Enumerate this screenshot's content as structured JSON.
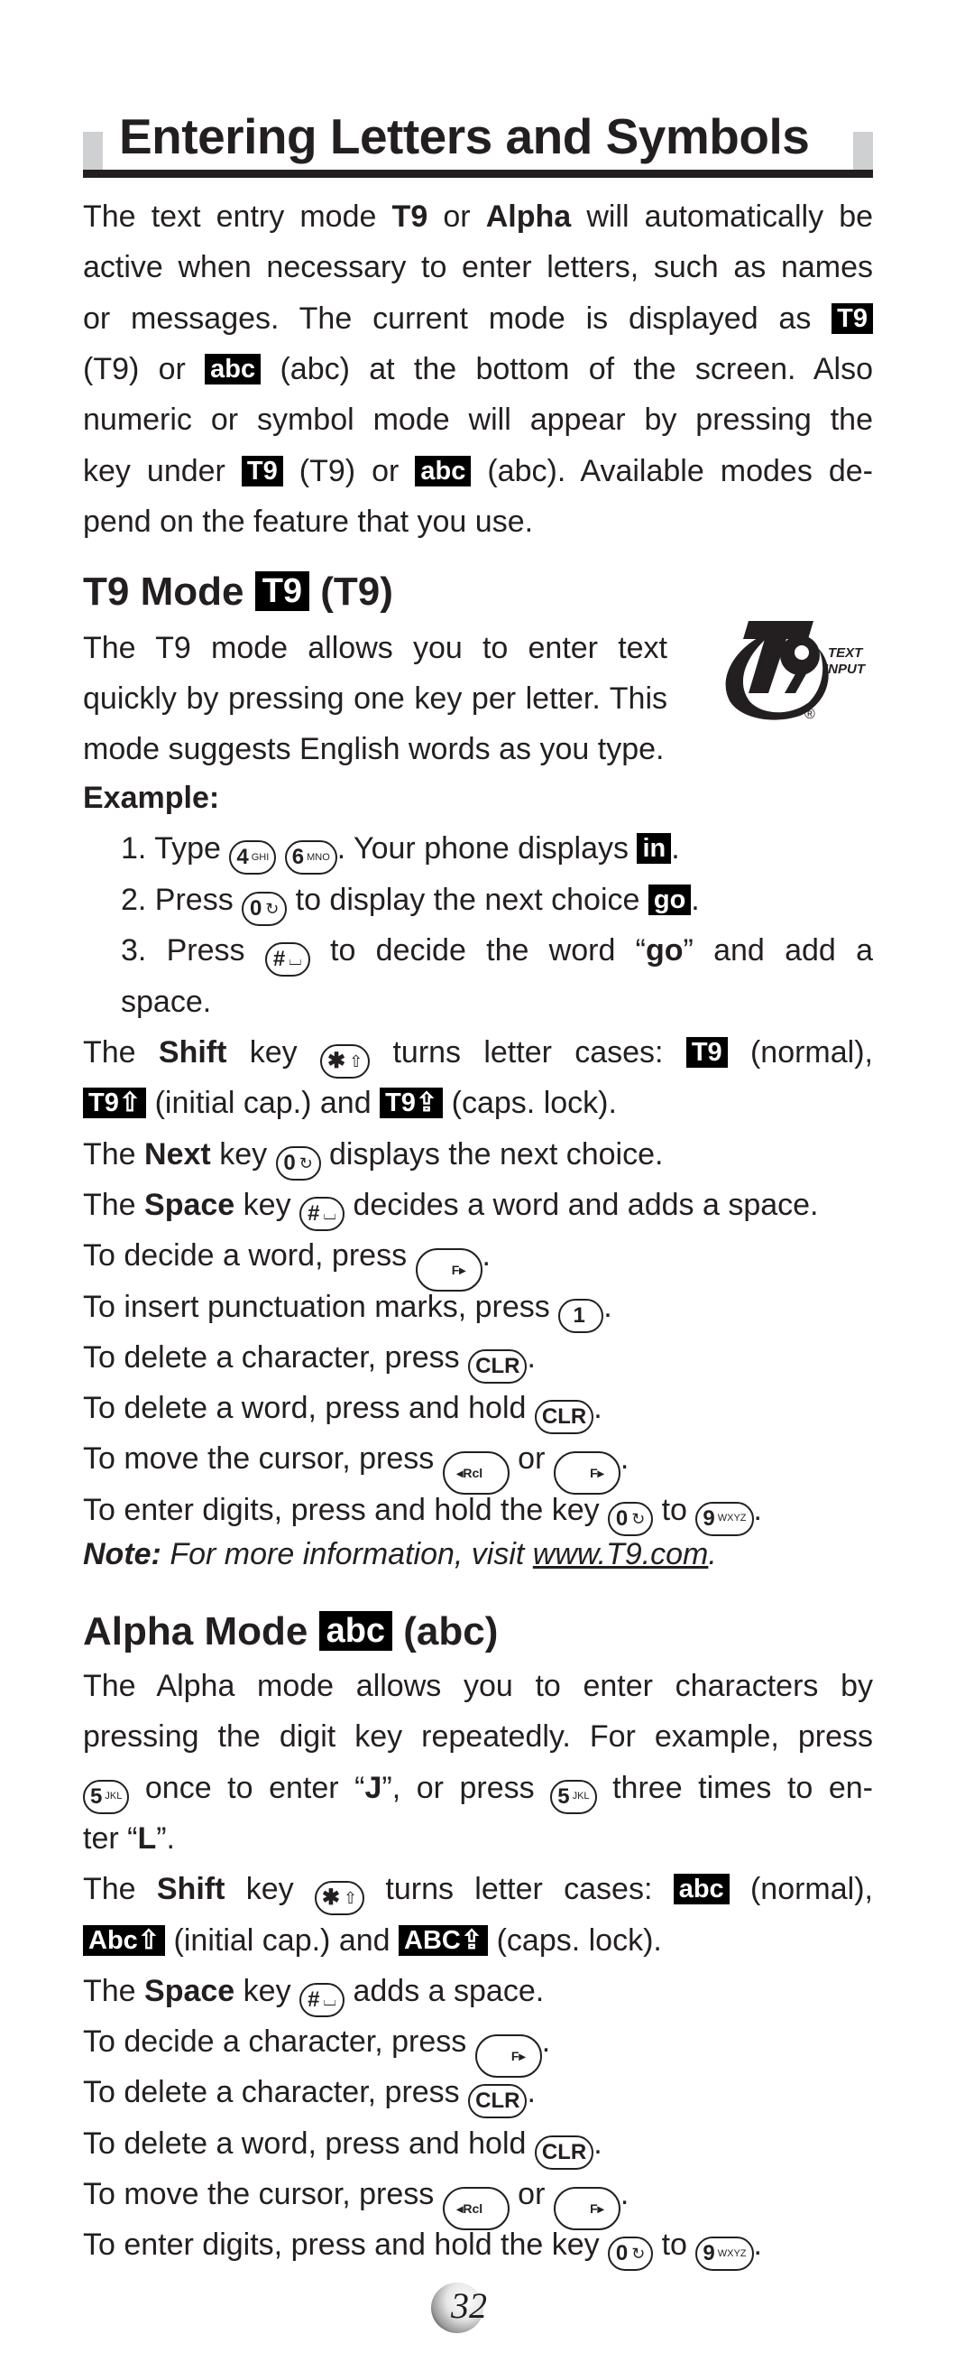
{
  "heading": "Entering Letters and Symbols",
  "intro": {
    "lines": [
      [
        "The text entry mode ",
        {
          "b": "T9"
        },
        " or ",
        {
          "b": "Alpha"
        },
        " will automatically be"
      ],
      [
        "active when necessary to enter letters, such as names"
      ],
      [
        "or messages. The current mode is displayed as ",
        {
          "badge": "T9"
        }
      ],
      [
        "(T9) or ",
        {
          "badge": "abc"
        },
        " (abc) at the bottom of the screen. Also"
      ],
      [
        "numeric or symbol mode will appear by pressing the"
      ],
      [
        "key under ",
        {
          "badge": "T9"
        },
        " (T9) or ",
        {
          "badge": "abc"
        },
        " (abc). Available modes de-"
      ],
      [
        "pend on the feature that you use."
      ]
    ]
  },
  "t9_section": {
    "title_prefix": "T9 Mode",
    "title_badge": "T9",
    "title_suffix": "(T9)",
    "logo": {
      "mark": "T9",
      "line1": "TEXT",
      "line2": "INPUT",
      "reg": "®"
    },
    "desc_lines": [
      "The T9 mode allows you to enter text",
      "quickly by pressing one key per letter. This",
      "mode suggests English words as you type."
    ],
    "example_label": "Example:",
    "steps": [
      [
        "1. Type ",
        {
          "key": "4",
          "sub": "GHI"
        },
        " ",
        {
          "key": "6",
          "sub": "MNO"
        },
        ". Your phone displays ",
        {
          "badge": "in"
        },
        "."
      ],
      [
        "2. Press ",
        {
          "key": "0",
          "sub": "↻"
        },
        " to display the next choice ",
        {
          "badge": "go"
        },
        "."
      ],
      [
        "3. Press ",
        {
          "key": "#",
          "sub": "⌴"
        },
        " to decide the word “",
        {
          "b": "go"
        },
        "” and add a"
      ],
      [
        "    space."
      ]
    ],
    "lines": [
      [
        "The ",
        {
          "b": "Shift"
        },
        " key ",
        {
          "key": "✱",
          "sub": "⇧"
        },
        " turns letter cases: ",
        {
          "badge": "T9"
        },
        " (normal),"
      ],
      [
        {
          "badge": "T9⇧"
        },
        " (initial cap.) and ",
        {
          "badge": "T9⇪"
        },
        " (caps. lock)."
      ],
      [
        "The ",
        {
          "b": "Next"
        },
        " key ",
        {
          "key": "0",
          "sub": "↻"
        },
        " displays the next choice."
      ],
      [
        "The ",
        {
          "b": "Space"
        },
        " key ",
        {
          "key": "#",
          "sub": "⌴"
        },
        " decides a word and adds a space."
      ],
      [
        "To decide a word, press ",
        {
          "wkey": "F▸"
        },
        "."
      ],
      [
        "To insert punctuation marks, press ",
        {
          "key": "1",
          "sub": " "
        },
        "."
      ],
      [
        "To delete a character, press ",
        {
          "key": "CLR"
        },
        "."
      ],
      [
        "To delete a word, press and hold ",
        {
          "key": "CLR"
        },
        "."
      ],
      [
        "To move the cursor, press ",
        {
          "wkey": "◂Rcl"
        },
        " or ",
        {
          "wkey": "F▸"
        },
        "."
      ],
      [
        "To enter digits, press and hold the key ",
        {
          "key": "0",
          "sub": "↻"
        },
        " to ",
        {
          "key": "9",
          "sub": "WXYZ"
        },
        "."
      ]
    ],
    "note_label": "Note:",
    "note_text": " For more information, visit ",
    "note_link": "www.T9.com",
    "note_end": "."
  },
  "alpha_section": {
    "title_prefix": "Alpha Mode",
    "title_badge": "abc",
    "title_suffix": "(abc)",
    "lines": [
      [
        "The Alpha mode allows you to enter characters by"
      ],
      [
        "pressing the digit key repeatedly. For example, press"
      ],
      [
        {
          "key": "5",
          "sub": "JKL"
        },
        " once to enter “",
        {
          "b": "J"
        },
        "”, or press ",
        {
          "key": "5",
          "sub": "JKL"
        },
        " three times to en-"
      ],
      [
        "ter “",
        {
          "b": "L"
        },
        "”."
      ],
      [
        "The ",
        {
          "b": "Shift"
        },
        " key ",
        {
          "key": "✱",
          "sub": "⇧"
        },
        " turns letter cases: ",
        {
          "badge": "abc"
        },
        " (normal),"
      ],
      [
        {
          "badge": "Abc⇧"
        },
        " (initial cap.) and ",
        {
          "badge": "ABC⇪"
        },
        " (caps. lock)."
      ],
      [
        "The ",
        {
          "b": "Space"
        },
        " key ",
        {
          "key": "#",
          "sub": "⌴"
        },
        " adds a space."
      ],
      [
        "To decide a character, press ",
        {
          "wkey": "F▸"
        },
        "."
      ],
      [
        "To delete a character, press ",
        {
          "key": "CLR"
        },
        "."
      ],
      [
        "To delete a word, press and hold ",
        {
          "key": "CLR"
        },
        "."
      ],
      [
        "To move the cursor, press ",
        {
          "wkey": "◂Rcl"
        },
        " or ",
        {
          "wkey": "F▸"
        },
        "."
      ],
      [
        "To enter digits, press and hold the key  ",
        {
          "key": "0",
          "sub": "↻"
        },
        " to ",
        {
          "key": "9",
          "sub": "WXYZ"
        },
        "."
      ]
    ]
  },
  "page_number": "32"
}
